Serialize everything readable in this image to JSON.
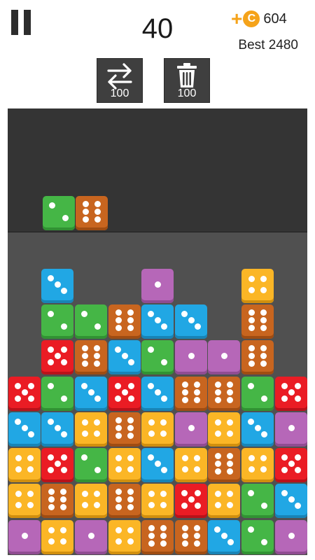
{
  "header": {
    "score": "40",
    "coin_plus": "+",
    "coin_symbol": "C",
    "coins": "604",
    "best_label": "Best",
    "best_value": "2480"
  },
  "tools": [
    {
      "name": "swap",
      "icon": "swap-arrows-icon",
      "cost": "100"
    },
    {
      "name": "trash",
      "icon": "trash-can-icon",
      "cost": "100"
    }
  ],
  "colors": {
    "orange": "#c8651f",
    "red": "#ea1c24",
    "blue": "#21a7e4",
    "green": "#45b646",
    "purple": "#b667b8",
    "yellow": "#fbb626",
    "coin": "#f5a31a",
    "drop_zone": "#343434",
    "board": "#505050"
  },
  "next_piece": [
    {
      "color": "green",
      "value": 2
    },
    {
      "color": "orange",
      "value": 6
    }
  ],
  "grid": [
    [
      null,
      null,
      null,
      null,
      null,
      null,
      null,
      null,
      null
    ],
    [
      null,
      {
        "color": "blue",
        "value": 3
      },
      null,
      null,
      {
        "color": "purple",
        "value": 1
      },
      null,
      null,
      {
        "color": "yellow",
        "value": 4
      },
      null
    ],
    [
      null,
      {
        "color": "green",
        "value": 2
      },
      {
        "color": "green",
        "value": 2
      },
      {
        "color": "orange",
        "value": 6
      },
      {
        "color": "blue",
        "value": 3
      },
      {
        "color": "blue",
        "value": 3
      },
      null,
      {
        "color": "orange",
        "value": 6
      },
      null
    ],
    [
      null,
      {
        "color": "red",
        "value": 5
      },
      {
        "color": "orange",
        "value": 6
      },
      {
        "color": "blue",
        "value": 3
      },
      {
        "color": "green",
        "value": 2
      },
      {
        "color": "purple",
        "value": 1
      },
      {
        "color": "purple",
        "value": 1
      },
      {
        "color": "orange",
        "value": 6
      },
      null
    ],
    [
      {
        "color": "red",
        "value": 5
      },
      {
        "color": "green",
        "value": 2
      },
      {
        "color": "blue",
        "value": 3
      },
      {
        "color": "red",
        "value": 5
      },
      {
        "color": "blue",
        "value": 3
      },
      {
        "color": "orange",
        "value": 6
      },
      {
        "color": "orange",
        "value": 6
      },
      {
        "color": "green",
        "value": 2
      },
      {
        "color": "red",
        "value": 5
      }
    ],
    [
      {
        "color": "blue",
        "value": 3
      },
      {
        "color": "blue",
        "value": 3
      },
      {
        "color": "yellow",
        "value": 4
      },
      {
        "color": "orange",
        "value": 6
      },
      {
        "color": "yellow",
        "value": 4
      },
      {
        "color": "purple",
        "value": 1
      },
      {
        "color": "yellow",
        "value": 4
      },
      {
        "color": "blue",
        "value": 3
      },
      {
        "color": "purple",
        "value": 1
      }
    ],
    [
      {
        "color": "yellow",
        "value": 4
      },
      {
        "color": "red",
        "value": 5
      },
      {
        "color": "green",
        "value": 2
      },
      {
        "color": "yellow",
        "value": 4
      },
      {
        "color": "blue",
        "value": 3
      },
      {
        "color": "yellow",
        "value": 4
      },
      {
        "color": "orange",
        "value": 6
      },
      {
        "color": "yellow",
        "value": 4
      },
      {
        "color": "red",
        "value": 5
      }
    ],
    [
      {
        "color": "yellow",
        "value": 4
      },
      {
        "color": "orange",
        "value": 6
      },
      {
        "color": "yellow",
        "value": 4
      },
      {
        "color": "orange",
        "value": 6
      },
      {
        "color": "yellow",
        "value": 4
      },
      {
        "color": "red",
        "value": 5
      },
      {
        "color": "yellow",
        "value": 4
      },
      {
        "color": "green",
        "value": 2
      },
      {
        "color": "blue",
        "value": 3
      }
    ],
    [
      {
        "color": "purple",
        "value": 1
      },
      {
        "color": "yellow",
        "value": 4
      },
      {
        "color": "purple",
        "value": 1
      },
      {
        "color": "yellow",
        "value": 4
      },
      {
        "color": "orange",
        "value": 6
      },
      {
        "color": "orange",
        "value": 6
      },
      {
        "color": "blue",
        "value": 3
      },
      {
        "color": "green",
        "value": 2
      },
      {
        "color": "purple",
        "value": 1
      }
    ]
  ]
}
